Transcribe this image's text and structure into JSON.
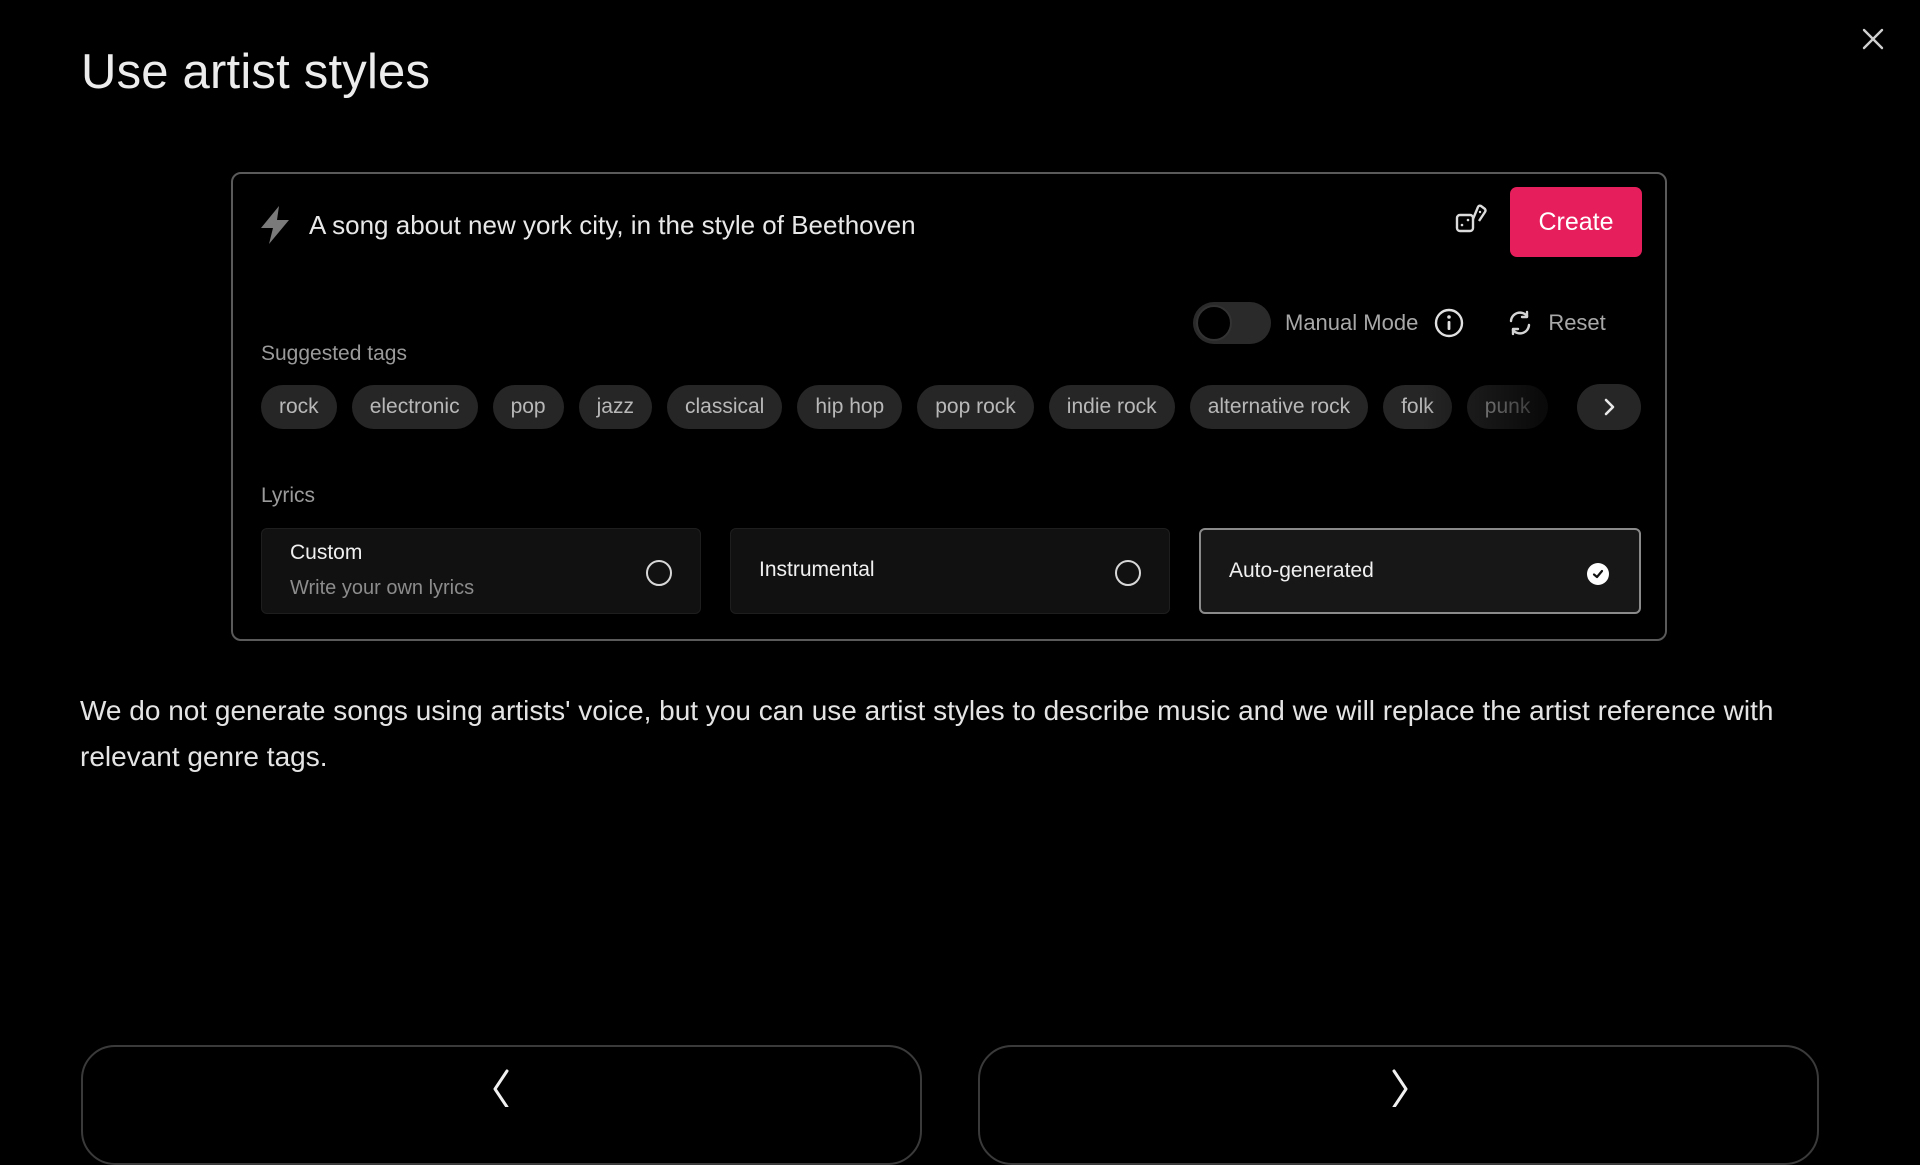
{
  "dialog": {
    "title": "Use artist styles",
    "close_icon": "close-icon"
  },
  "prompt": {
    "icon": "lightning-bolt-icon",
    "text": "A song about new york city, in the style of Beethoven",
    "random_icon": "dice-icon",
    "create_label": "Create",
    "accent_color": "#e61e5b"
  },
  "mode": {
    "manual_mode_label": "Manual Mode",
    "manual_mode_on": false,
    "info_icon": "info-icon",
    "reset_label": "Reset",
    "reset_icon": "refresh-icon"
  },
  "suggested_tags": {
    "label": "Suggested tags",
    "tags": [
      "rock",
      "electronic",
      "pop",
      "jazz",
      "classical",
      "hip hop",
      "pop rock",
      "indie rock",
      "alternative rock",
      "folk",
      "punk"
    ],
    "next_icon": "chevron-right-icon"
  },
  "lyrics": {
    "label": "Lyrics",
    "options": [
      {
        "title": "Custom",
        "subtitle": "Write your own lyrics",
        "selected": false
      },
      {
        "title": "Instrumental",
        "subtitle": "",
        "selected": false
      },
      {
        "title": "Auto-generated",
        "subtitle": "",
        "selected": true
      }
    ]
  },
  "notice": {
    "text": "We do not generate songs using artists' voice, but you can use artist styles to describe music and we will replace the artist reference with relevant genre tags."
  },
  "navigation": {
    "prev_icon": "chevron-left-icon",
    "next_icon": "chevron-right-icon"
  }
}
